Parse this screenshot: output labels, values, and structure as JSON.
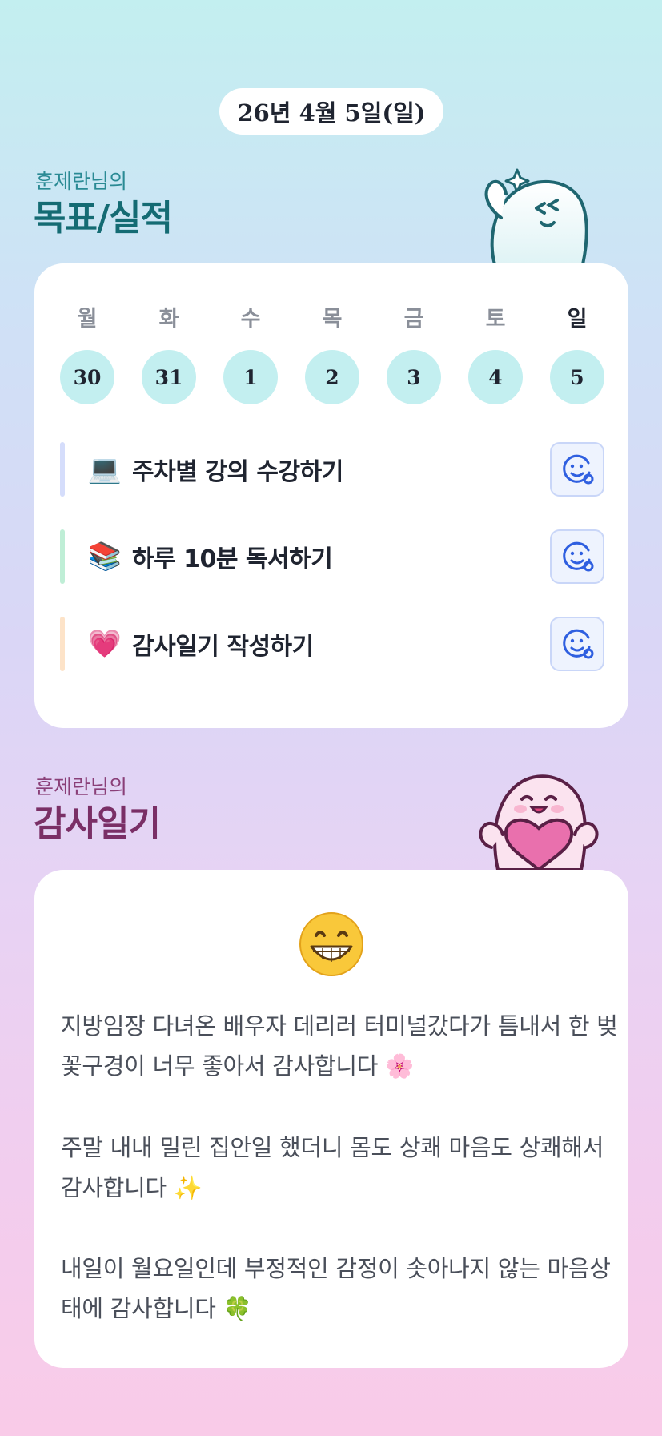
{
  "header": {
    "date": "26년 4월 5일(일)"
  },
  "goals_section": {
    "subtitle": "훈제란님의",
    "title": "목표/실적"
  },
  "week": [
    {
      "day": "월",
      "date": "30"
    },
    {
      "day": "화",
      "date": "31"
    },
    {
      "day": "수",
      "date": "1"
    },
    {
      "day": "목",
      "date": "2"
    },
    {
      "day": "금",
      "date": "3"
    },
    {
      "day": "토",
      "date": "4"
    },
    {
      "day": "일",
      "date": "5"
    }
  ],
  "goals": [
    {
      "icon": "💻",
      "label": "주차별 강의 수강하기",
      "accent": "#d5ddfb"
    },
    {
      "icon": "📚",
      "label": "하루 10분 독서하기",
      "accent": "#bfeed6"
    },
    {
      "icon": "💗",
      "label": "감사일기 작성하기",
      "accent": "#fde3c8"
    }
  ],
  "diary_section": {
    "subtitle": "훈제란님의",
    "title": "감사일기"
  },
  "diary": {
    "mood_icon": "😁",
    "entries": [
      {
        "text": "지방임장 다녀온 배우자 데리러 터미널갔다가 틈내서 한 벚꽃구경이 너무 좋아서 감사합니다",
        "emoji": "🌸"
      },
      {
        "text": "주말 내내 밀린 집안일 했더니 몸도 상쾌 마음도 상쾌해서 감사합니다",
        "emoji": "✨"
      },
      {
        "text": "내일이 월요일인데 부정적인 감정이 솟아나지 않는 마음상태에 감사합니다",
        "emoji": "🍀"
      }
    ]
  },
  "colors": {
    "mint": "#c3eff0",
    "teal_title": "#146b73",
    "plum_title": "#7a2f66",
    "face_icon": "#2f5fe0"
  }
}
